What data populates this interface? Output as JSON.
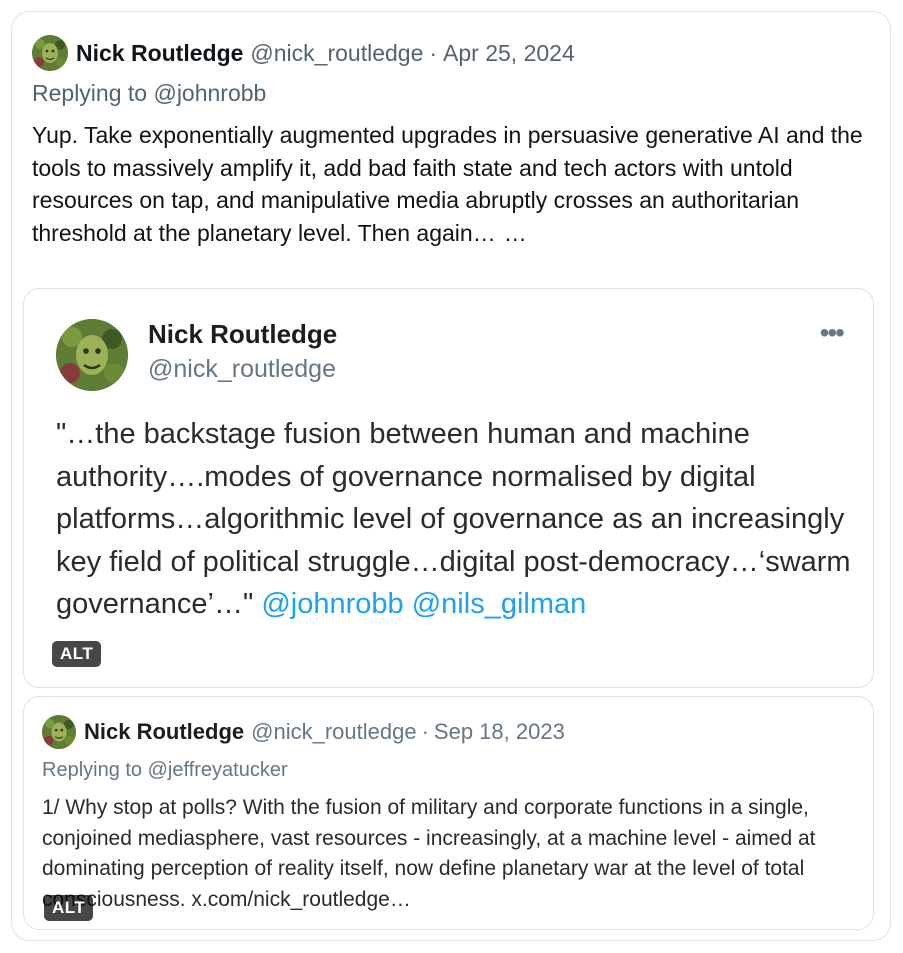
{
  "tweet": {
    "author_name": "Nick Routledge",
    "author_handle": "@nick_routledge",
    "separator": "·",
    "date": "Apr 25, 2024",
    "replying_prefix": "Replying to ",
    "replying_to": "@johnrobb",
    "text": "Yup. Take exponentially augmented upgrades in persuasive generative AI and the tools to massively amplify it, add bad faith state and tech actors with untold resources on tap, and manipulative media abruptly crosses an authoritarian threshold at the planetary level. Then again…",
    "more": "…",
    "avatar_icon": "portrait-avatar-icon"
  },
  "image1": {
    "author_name": "Nick Routledge",
    "author_handle": "@nick_routledge",
    "menu": "•••",
    "quote_text": "\"…the backstage fusion between human and machine authority….modes of governance normalised by digital platforms…algorithmic level of governance as an increasingly key field of political struggle…digital post-democracy…‘swarm governance’…\" ",
    "mention1": "@johnrobb",
    "mention2": "@nils_gilman",
    "alt_badge": "ALT"
  },
  "image2": {
    "author_name": "Nick Routledge",
    "author_handle": "@nick_routledge",
    "separator": "·",
    "date": "Sep 18, 2023",
    "replying_prefix": "Replying to ",
    "replying_to": "@jeffreyatucker",
    "text": "1/ Why stop at polls? With the fusion of military and corporate functions in a single, conjoined mediasphere, vast resources - increasingly, at a machine level - aimed at dominating perception of reality itself, now define planetary war at the level of total consciousness. x.com/nick_routledge…",
    "alt_badge": "ALT"
  },
  "colors": {
    "text": "#0f1419",
    "secondary": "#536471",
    "link": "#1da1f2",
    "border": "#dfe3e6"
  }
}
